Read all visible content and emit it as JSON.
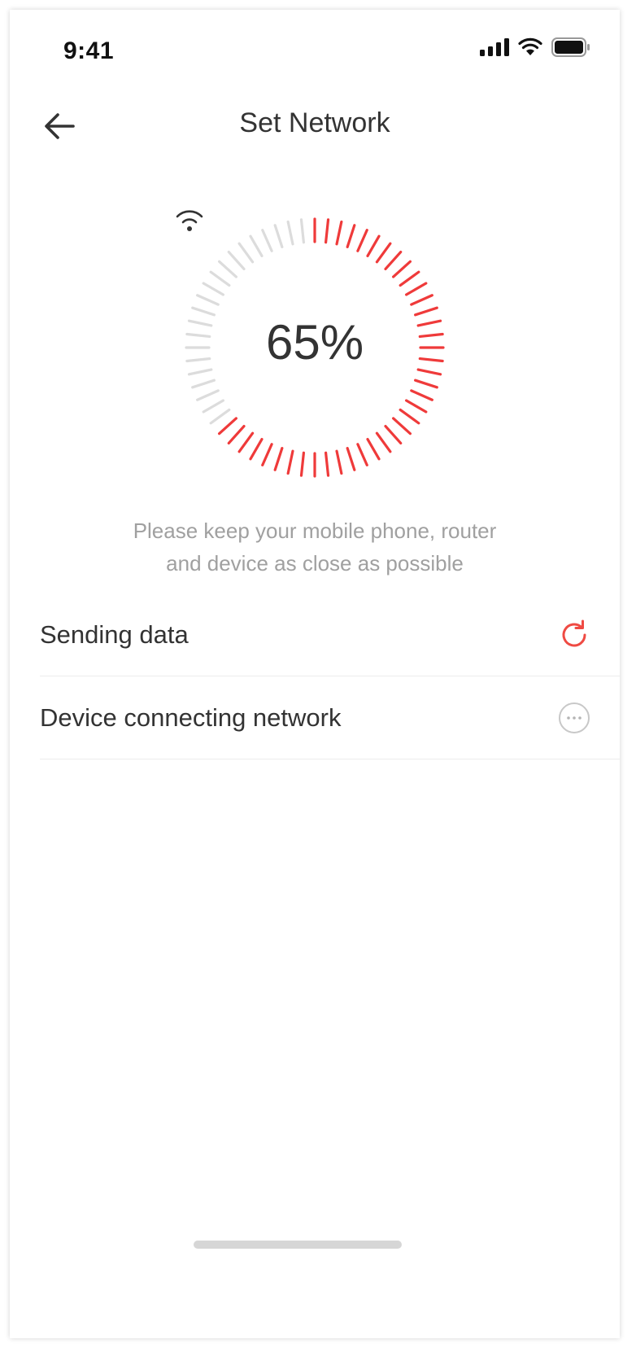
{
  "status_bar": {
    "time": "9:41",
    "icons": [
      "cellular-signal-icon",
      "wifi-icon",
      "battery-icon"
    ]
  },
  "header": {
    "back_icon": "arrow-left-icon",
    "title": "Set Network"
  },
  "progress": {
    "value": 0.65,
    "label": "65%",
    "icon": "wifi-icon",
    "active_color": "#ef3a3a",
    "inactive_color": "#dcdcdc"
  },
  "hint": {
    "line1": "Please keep your mobile phone, router",
    "line2": "and device as close as possible"
  },
  "steps": [
    {
      "label": "Sending data",
      "status_icon": "refresh-icon",
      "color": "#ef4a43"
    },
    {
      "label": "Device connecting network",
      "status_icon": "more-dots-icon",
      "color": "#c8c8c8"
    }
  ]
}
